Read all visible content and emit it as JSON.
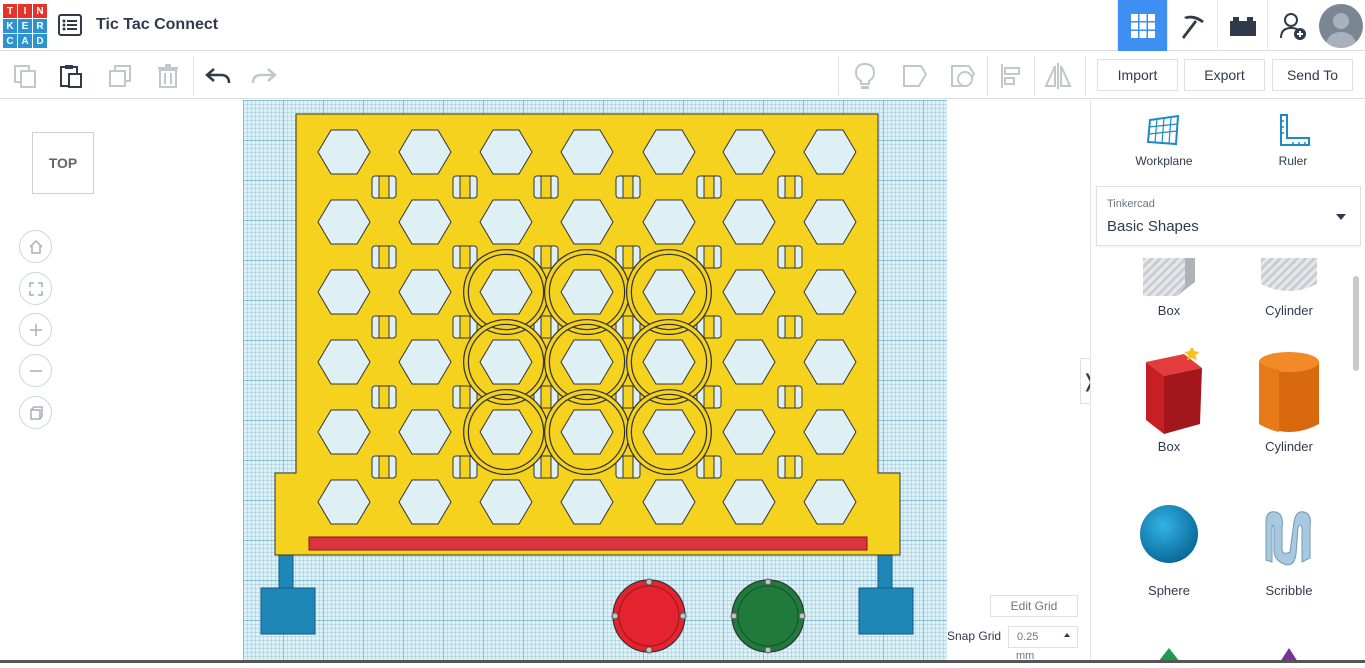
{
  "app": {
    "logo_letters": [
      "T",
      "I",
      "N",
      "K",
      "E",
      "R",
      "C",
      "A",
      "D"
    ],
    "logo_colors": [
      "#e5332a",
      "#e5332a",
      "#e5332a",
      "#2c93d3",
      "#2c93d3",
      "#2c93d3",
      "#2c93d3",
      "#2c93d3",
      "#2c93d3"
    ],
    "title": "Tic Tac Connect"
  },
  "topbar": {
    "icons": [
      "grid-view-icon",
      "pickaxe-icon",
      "bricks-icon",
      "add-user-icon",
      "avatar"
    ],
    "accent": "#3f8ef2"
  },
  "toolbar": {
    "tools": [
      "copy-icon",
      "paste-icon",
      "duplicate-icon",
      "delete-icon",
      "undo-icon",
      "redo-icon"
    ],
    "right_tools": [
      "lightbulb-icon",
      "note-icon",
      "shape-note-icon",
      "align-icon",
      "mirror-icon"
    ],
    "import_label": "Import",
    "export_label": "Export",
    "send_to_label": "Send To"
  },
  "view": {
    "cube_label": "TOP",
    "nav": [
      "home-icon",
      "fit-icon",
      "zoom-in-icon",
      "zoom-out-icon",
      "perspective-icon"
    ]
  },
  "canvas": {
    "board_color": "#f5d21e",
    "bar_color": "#d93440",
    "leg_color": "#1f86b8",
    "token_red": "#e5232e",
    "token_green": "#1f7a3c"
  },
  "grid": {
    "edit_label": "Edit Grid",
    "snap_label": "Snap Grid",
    "snap_value": "0.25",
    "snap_unit": "mm"
  },
  "panel": {
    "workplane_label": "Workplane",
    "ruler_label": "Ruler",
    "library_source": "Tinkercad",
    "library_name": "Basic Shapes",
    "shapes": [
      {
        "label": "Box"
      },
      {
        "label": "Cylinder"
      },
      {
        "label": "Box"
      },
      {
        "label": "Cylinder"
      },
      {
        "label": "Sphere"
      },
      {
        "label": "Scribble"
      }
    ]
  }
}
